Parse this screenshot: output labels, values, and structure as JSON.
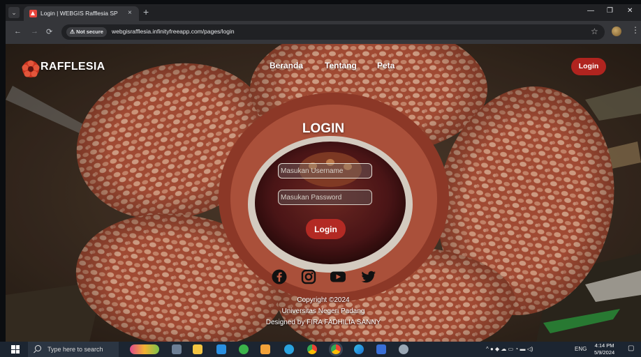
{
  "browser": {
    "tab_title": "Login | WEBGIS Rafflesia SP",
    "tab_close": "×",
    "new_tab": "+",
    "security_label": "Not secure",
    "url": "webgisrafflesia.infinityfreeapp.com/pages/login",
    "icons": [
      "tab-menu-icon",
      "back-icon",
      "forward-icon",
      "reload-icon",
      "star-icon",
      "extension-icon",
      "menu-icon",
      "minimize-icon",
      "restore-icon",
      "close-icon"
    ]
  },
  "site": {
    "brand": "RAFFLESIA",
    "nav": [
      "Beranda",
      "Tentang",
      "Peta"
    ],
    "nav_login": "Login"
  },
  "login": {
    "title": "LOGIN",
    "username_placeholder": "Masukan Username",
    "password_placeholder": "Masukan Password",
    "button": "Login"
  },
  "social": [
    "facebook-icon",
    "instagram-icon",
    "youtube-icon",
    "twitter-icon"
  ],
  "footer": {
    "copyright": "Copyright ©2024",
    "university": "Universitas Negeri Padang",
    "designer": "Designed by FIRA FADHILIA SANNY"
  },
  "taskbar": {
    "search_placeholder": "Type here to search",
    "language": "ENG",
    "time": "4:14 PM",
    "date": "5/9/2024"
  },
  "colors": {
    "accent": "#b0241f",
    "chrome_dark": "#202124",
    "chrome_toolbar": "#35363a",
    "taskbar": "#1c2531"
  }
}
